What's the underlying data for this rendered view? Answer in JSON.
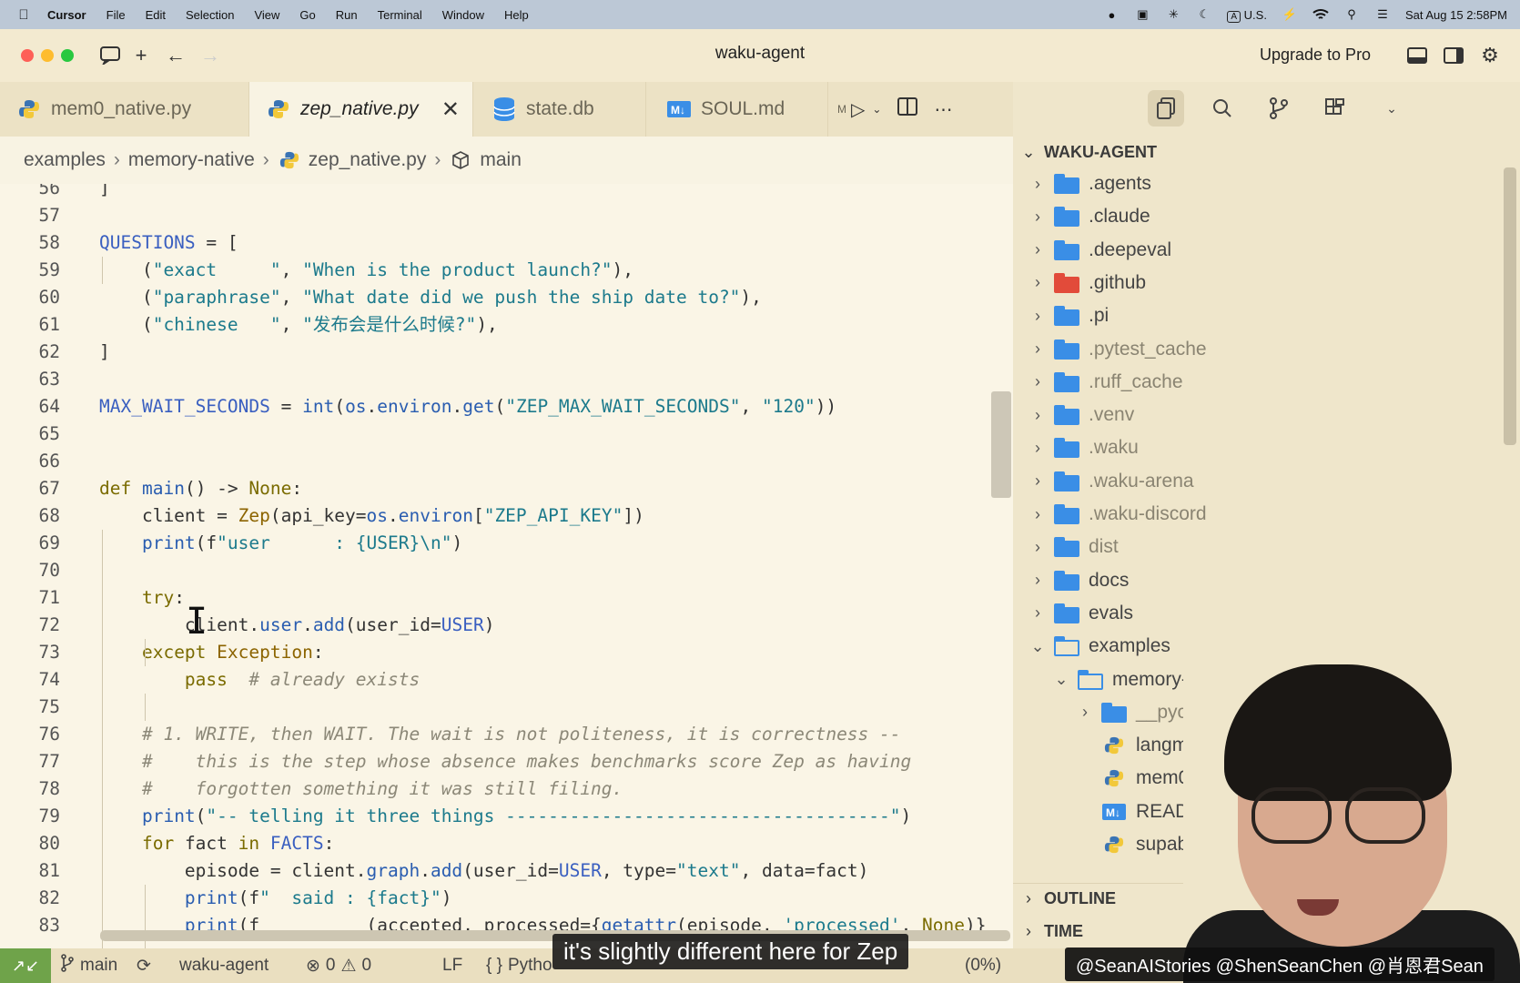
{
  "menubar": {
    "app": "Cursor",
    "items": [
      "File",
      "Edit",
      "Selection",
      "View",
      "Go",
      "Run",
      "Terminal",
      "Window",
      "Help"
    ],
    "input_source": "U.S.",
    "datetime": "Sat Aug 15  2:58PM"
  },
  "window": {
    "title": "waku-agent",
    "upgrade_label": "Upgrade to Pro"
  },
  "tabs": [
    {
      "label": "mem0_native.py",
      "icon": "python-icon",
      "active": false
    },
    {
      "label": "zep_native.py",
      "icon": "python-icon",
      "active": true
    },
    {
      "label": "state.db",
      "icon": "database-icon",
      "active": false
    },
    {
      "label": "SOUL.md",
      "icon": "markdown-icon",
      "active": false
    }
  ],
  "tab_overflow_label": "M",
  "breadcrumb": {
    "items": [
      "examples",
      "memory-native",
      "zep_native.py",
      "main"
    ]
  },
  "editor": {
    "lines": [
      {
        "n": "56",
        "text": "]"
      },
      {
        "n": "57",
        "text": ""
      },
      {
        "n": "58",
        "text": "QUESTIONS = ["
      },
      {
        "n": "59",
        "text": "    (\"exact     \", \"When is the product launch?\"),"
      },
      {
        "n": "60",
        "text": "    (\"paraphrase\", \"What date did we push the ship date to?\"),"
      },
      {
        "n": "61",
        "text": "    (\"chinese   \", \"发布会是什么时候?\"),"
      },
      {
        "n": "62",
        "text": "]"
      },
      {
        "n": "63",
        "text": ""
      },
      {
        "n": "64",
        "text": "MAX_WAIT_SECONDS = int(os.environ.get(\"ZEP_MAX_WAIT_SECONDS\", \"120\"))"
      },
      {
        "n": "65",
        "text": ""
      },
      {
        "n": "66",
        "text": ""
      },
      {
        "n": "67",
        "text": "def main() -> None:"
      },
      {
        "n": "68",
        "text": "    client = Zep(api_key=os.environ[\"ZEP_API_KEY\"])"
      },
      {
        "n": "69",
        "text": "    print(f\"user      : {USER}\\n\")"
      },
      {
        "n": "70",
        "text": ""
      },
      {
        "n": "71",
        "text": "    try:"
      },
      {
        "n": "72",
        "text": "        client.user.add(user_id=USER)"
      },
      {
        "n": "73",
        "text": "    except Exception:"
      },
      {
        "n": "74",
        "text": "        pass  # already exists"
      },
      {
        "n": "75",
        "text": ""
      },
      {
        "n": "76",
        "text": "    # 1. WRITE, then WAIT. The wait is not politeness, it is correctness --"
      },
      {
        "n": "77",
        "text": "    #    this is the step whose absence makes benchmarks score Zep as having"
      },
      {
        "n": "78",
        "text": "    #    forgotten something it was still filing."
      },
      {
        "n": "79",
        "text": "    print(\"-- telling it three things ------------------------------------\")"
      },
      {
        "n": "80",
        "text": "    for fact in FACTS:"
      },
      {
        "n": "81",
        "text": "        episode = client.graph.add(user_id=USER, type=\"text\", data=fact)"
      },
      {
        "n": "82",
        "text": "        print(f\"  said : {fact}\")"
      },
      {
        "n": "83",
        "text": "        print(f\"          (accepted, processed={getattr(episode, 'processed', None)}"
      }
    ]
  },
  "explorer": {
    "root": "WAKU-AGENT",
    "items": [
      {
        "label": ".agents",
        "kind": "folder",
        "expanded": false,
        "depth": 0
      },
      {
        "label": ".claude",
        "kind": "folder",
        "expanded": false,
        "depth": 0
      },
      {
        "label": ".deepeval",
        "kind": "folder",
        "expanded": false,
        "depth": 0
      },
      {
        "label": ".github",
        "kind": "git-folder",
        "expanded": false,
        "depth": 0
      },
      {
        "label": ".pi",
        "kind": "folder",
        "expanded": false,
        "depth": 0
      },
      {
        "label": ".pytest_cache",
        "kind": "folder",
        "expanded": false,
        "depth": 0,
        "dim": true
      },
      {
        "label": ".ruff_cache",
        "kind": "folder",
        "expanded": false,
        "depth": 0,
        "dim": true
      },
      {
        "label": ".venv",
        "kind": "folder",
        "expanded": false,
        "depth": 0,
        "dim": true
      },
      {
        "label": ".waku",
        "kind": "folder",
        "expanded": false,
        "depth": 0,
        "dim": true
      },
      {
        "label": ".waku-arena",
        "kind": "folder",
        "expanded": false,
        "depth": 0,
        "dim": true
      },
      {
        "label": ".waku-discord",
        "kind": "folder",
        "expanded": false,
        "depth": 0,
        "dim": true
      },
      {
        "label": "dist",
        "kind": "folder",
        "expanded": false,
        "depth": 0,
        "dim": true
      },
      {
        "label": "docs",
        "kind": "folder",
        "expanded": false,
        "depth": 0
      },
      {
        "label": "evals",
        "kind": "folder",
        "expanded": false,
        "depth": 0
      },
      {
        "label": "examples",
        "kind": "folder",
        "expanded": true,
        "depth": 0
      },
      {
        "label": "memory-nativ",
        "kind": "folder",
        "expanded": true,
        "depth": 1
      },
      {
        "label": "__pycache",
        "kind": "folder",
        "expanded": false,
        "depth": 2,
        "dim": true
      },
      {
        "label": "langmem_",
        "kind": "python",
        "depth": 2
      },
      {
        "label": "mem0_na",
        "kind": "python",
        "depth": 2
      },
      {
        "label": "README.",
        "kind": "markdown",
        "depth": 2
      },
      {
        "label": "supabase_",
        "kind": "python",
        "depth": 2
      }
    ],
    "outline_label": "OUTLINE",
    "timeline_label": "TIME"
  },
  "statusbar": {
    "branch": "main",
    "workspace": "waku-agent",
    "errors": "0",
    "warnings": "0",
    "eol": "LF",
    "language": "Pytho",
    "zoom": "(0%)"
  },
  "overlay": {
    "subtitle": "it's slightly different here for Zep",
    "handles": "@SeanAIStories @ShenSeanChen @肖恩君Sean"
  },
  "colors": {
    "editor_bg": "#faf5e6",
    "sidebar_bg": "#efe6cb",
    "folder": "#3a8ee6",
    "remote_indicator": "#6fa34a"
  }
}
